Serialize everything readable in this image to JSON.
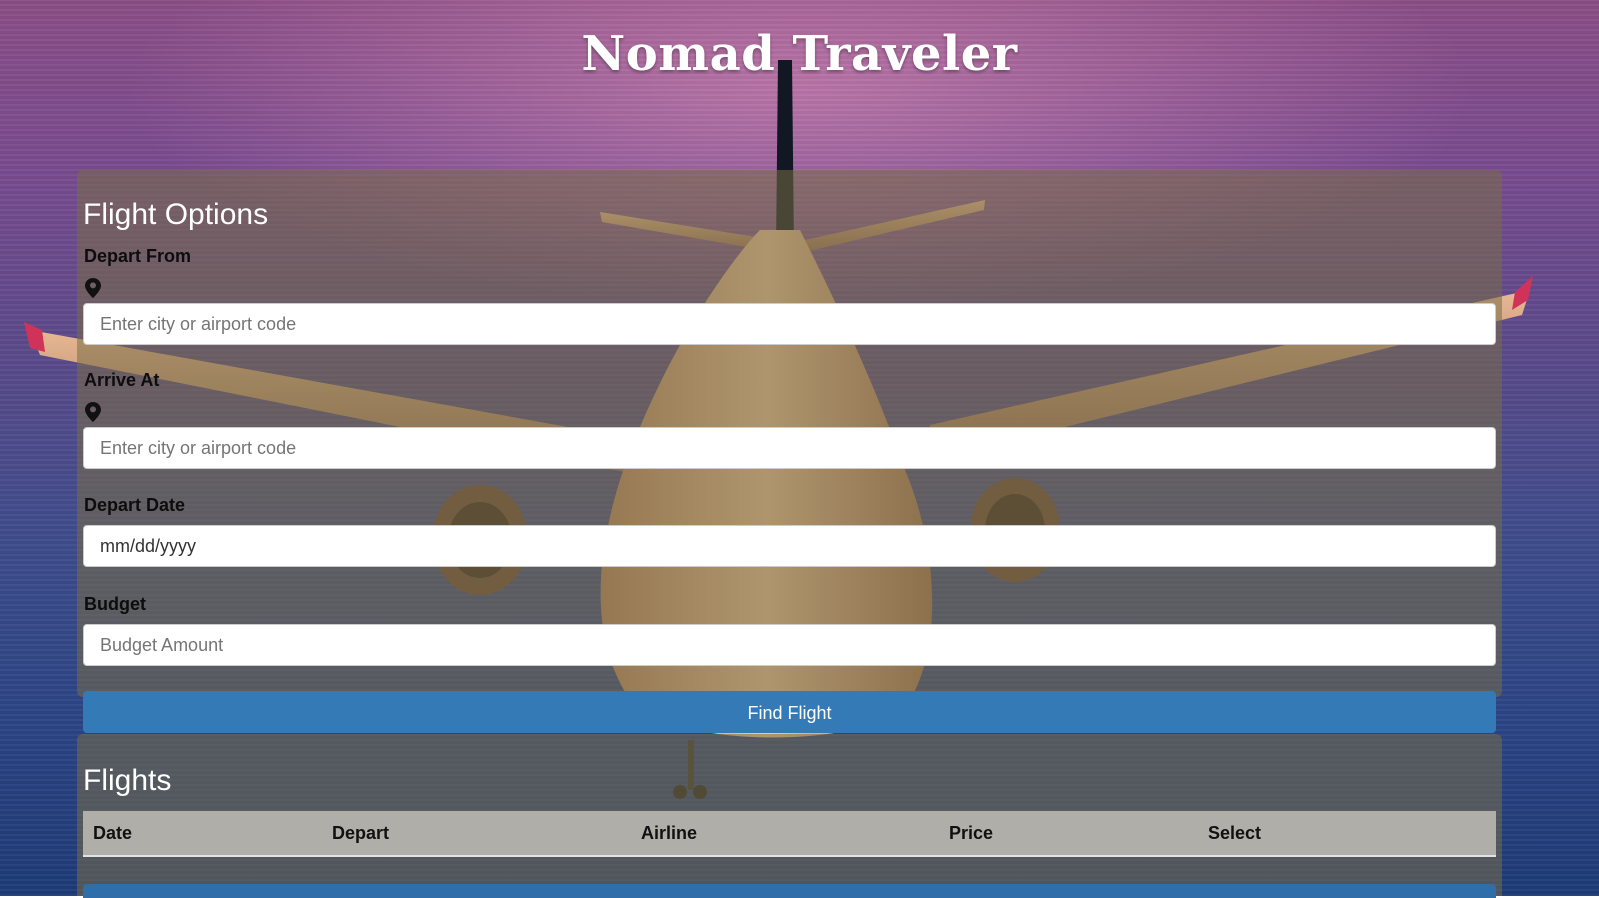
{
  "header": {
    "title": "Nomad Traveler"
  },
  "flight_options": {
    "heading": "Flight Options",
    "depart_from": {
      "label": "Depart From",
      "placeholder": "Enter city or airport code",
      "icon": "map-marker-icon"
    },
    "arrive_at": {
      "label": "Arrive At",
      "placeholder": "Enter city or airport code",
      "icon": "map-marker-icon"
    },
    "depart_date": {
      "label": "Depart Date",
      "placeholder": "mm/dd/yyyy"
    },
    "budget": {
      "label": "Budget",
      "placeholder": "Budget Amount"
    },
    "submit_label": "Find Flight"
  },
  "flights": {
    "heading": "Flights",
    "columns": [
      "Date",
      "Depart",
      "Airline",
      "Price",
      "Select"
    ]
  },
  "colors": {
    "primary_button": "#337ab7",
    "panel_overlay": "rgba(120,110,70,0.55)",
    "table_header": "#b0aea8"
  }
}
